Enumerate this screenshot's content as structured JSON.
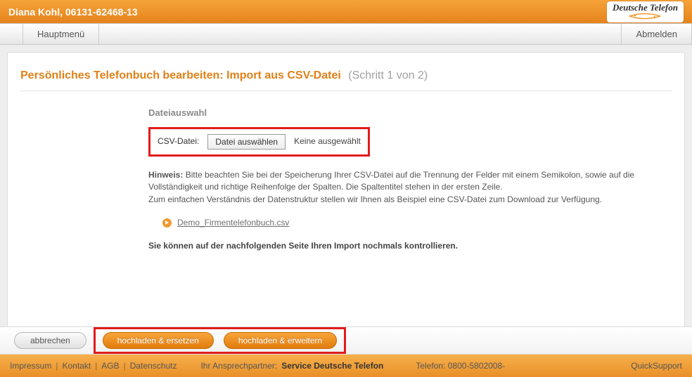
{
  "header": {
    "user_line": "Diana Kohl, 06131-62468-13",
    "brand": "Deutsche Telefon"
  },
  "menu": {
    "main": "Hauptmenü",
    "logout": "Abmelden"
  },
  "page": {
    "title": "Persönliches Telefonbuch bearbeiten: Import aus CSV-Datei",
    "step": "(Schritt 1 von 2)"
  },
  "form": {
    "section_heading": "Dateiauswahl",
    "file_label": "CSV-Datei:",
    "choose_button": "Datei auswählen",
    "no_file_selected": "Keine ausgewählt",
    "hint_label": "Hinweis:",
    "hint_text_1": "Bitte beachten Sie bei der Speicherung Ihrer CSV-Datei auf die Trennung der Felder mit einem Semikolon, sowie auf die Vollständigkeit und richtige Reihenfolge der Spalten. Die Spaltentitel stehen in der ersten Zeile.",
    "hint_text_2": "Zum einfachen Verständnis der Datenstruktur stellen wir Ihnen als Beispiel eine CSV-Datei zum Download zur Verfügung.",
    "download_link": "Demo_Firmentelefonbuch.csv",
    "confirm_line": "Sie können auf der nachfolgenden Seite Ihren Import nochmals kontrollieren."
  },
  "actions": {
    "cancel": "abbrechen",
    "upload_replace": "hochladen & ersetzen",
    "upload_extend": "hochladen & erweitern"
  },
  "footer": {
    "links": [
      "Impressum",
      "Kontakt",
      "AGB",
      "Datenschutz"
    ],
    "contact_label": "Ihr Ansprechpartner:",
    "contact_value": "Service Deutsche Telefon",
    "phone_label": "Telefon:",
    "phone_value": "0800-5802008-",
    "quicksupport": "QuickSupport"
  },
  "highlight_color": "#e21b1b"
}
